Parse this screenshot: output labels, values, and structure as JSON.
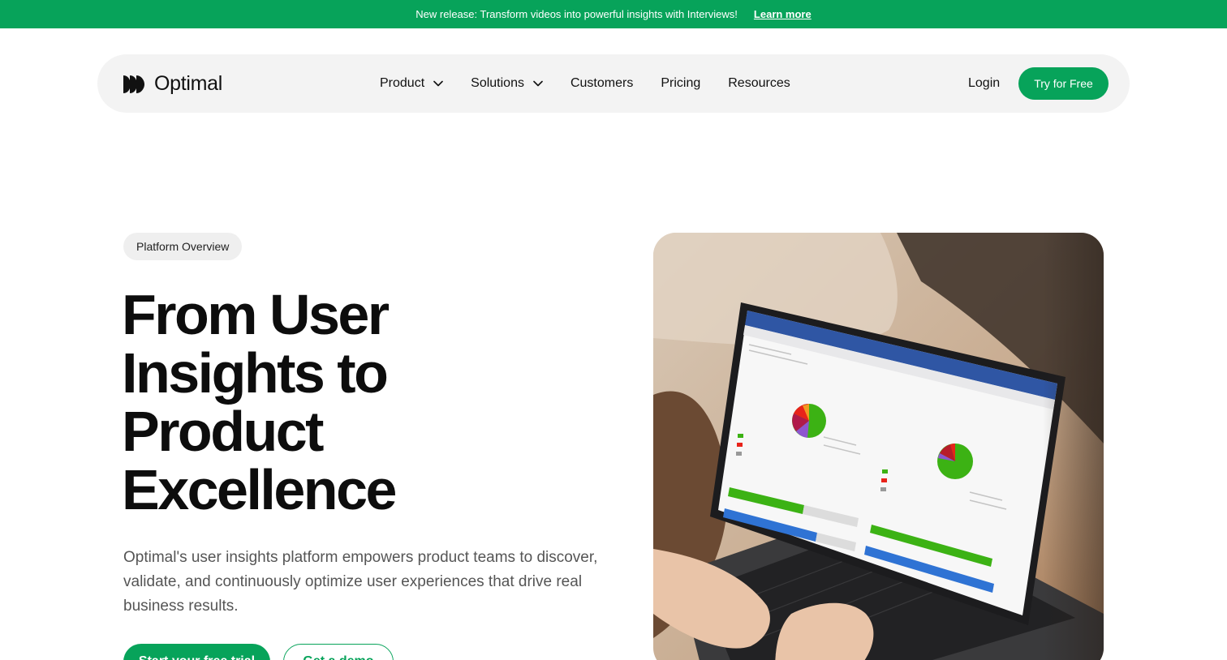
{
  "banner": {
    "text": "New release: Transform videos into powerful insights with Interviews!",
    "link": "Learn more"
  },
  "nav": {
    "logo": "Optimal",
    "items": [
      {
        "label": "Product",
        "has_dropdown": true
      },
      {
        "label": "Solutions",
        "has_dropdown": true
      },
      {
        "label": "Customers"
      },
      {
        "label": "Pricing"
      },
      {
        "label": "Resources"
      }
    ],
    "login": "Login",
    "cta": "Try for Free"
  },
  "hero": {
    "badge": "Platform Overview",
    "title": "From User Insights to Product Excellence",
    "subtitle": "Optimal's user insights platform empowers product teams to discover, validate, and continuously optimize user experiences that drive real business results.",
    "primary_button": "Start your free trial",
    "secondary_button": "Get a demo"
  },
  "colors": {
    "brand": "#07a35a",
    "nav_bg": "#f3f3f3",
    "text": "#111111"
  }
}
